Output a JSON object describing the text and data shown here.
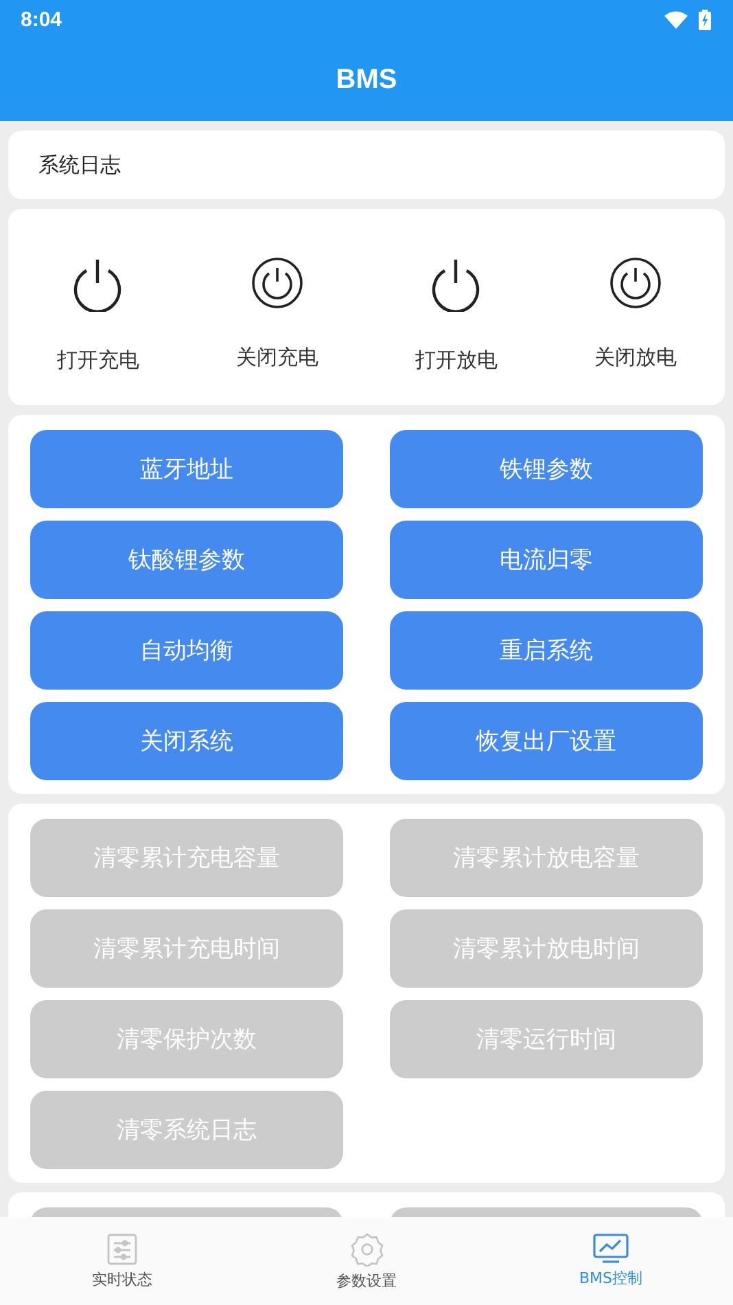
{
  "status_bar": {
    "time": "8:04"
  },
  "app_bar": {
    "title": "BMS"
  },
  "log": {
    "label": "系统日志"
  },
  "power_controls": [
    {
      "label": "打开充电",
      "kind": "open"
    },
    {
      "label": "关闭充电",
      "kind": "close"
    },
    {
      "label": "打开放电",
      "kind": "open"
    },
    {
      "label": "关闭放电",
      "kind": "close"
    }
  ],
  "command_buttons": [
    {
      "label": "蓝牙地址",
      "disabled": false
    },
    {
      "label": "铁锂参数",
      "disabled": false
    },
    {
      "label": "钛酸锂参数",
      "disabled": false
    },
    {
      "label": "电流归零",
      "disabled": false
    },
    {
      "label": "自动均衡",
      "disabled": false
    },
    {
      "label": "重启系统",
      "disabled": false
    },
    {
      "label": "关闭系统",
      "disabled": false
    },
    {
      "label": "恢复出厂设置",
      "disabled": false
    }
  ],
  "clear_buttons": [
    {
      "label": "清零累计充电容量",
      "disabled": true
    },
    {
      "label": "清零累计放电容量",
      "disabled": true
    },
    {
      "label": "清零累计充电时间",
      "disabled": true
    },
    {
      "label": "清零累计放电时间",
      "disabled": true
    },
    {
      "label": "清零保护次数",
      "disabled": true
    },
    {
      "label": "清零运行时间",
      "disabled": true
    },
    {
      "label": "清零系统日志",
      "disabled": true
    }
  ],
  "bottom_nav": [
    {
      "label": "实时状态",
      "kind": "status",
      "selected": false
    },
    {
      "label": "参数设置",
      "kind": "settings",
      "selected": false
    },
    {
      "label": "BMS控制",
      "kind": "control",
      "selected": true
    }
  ]
}
